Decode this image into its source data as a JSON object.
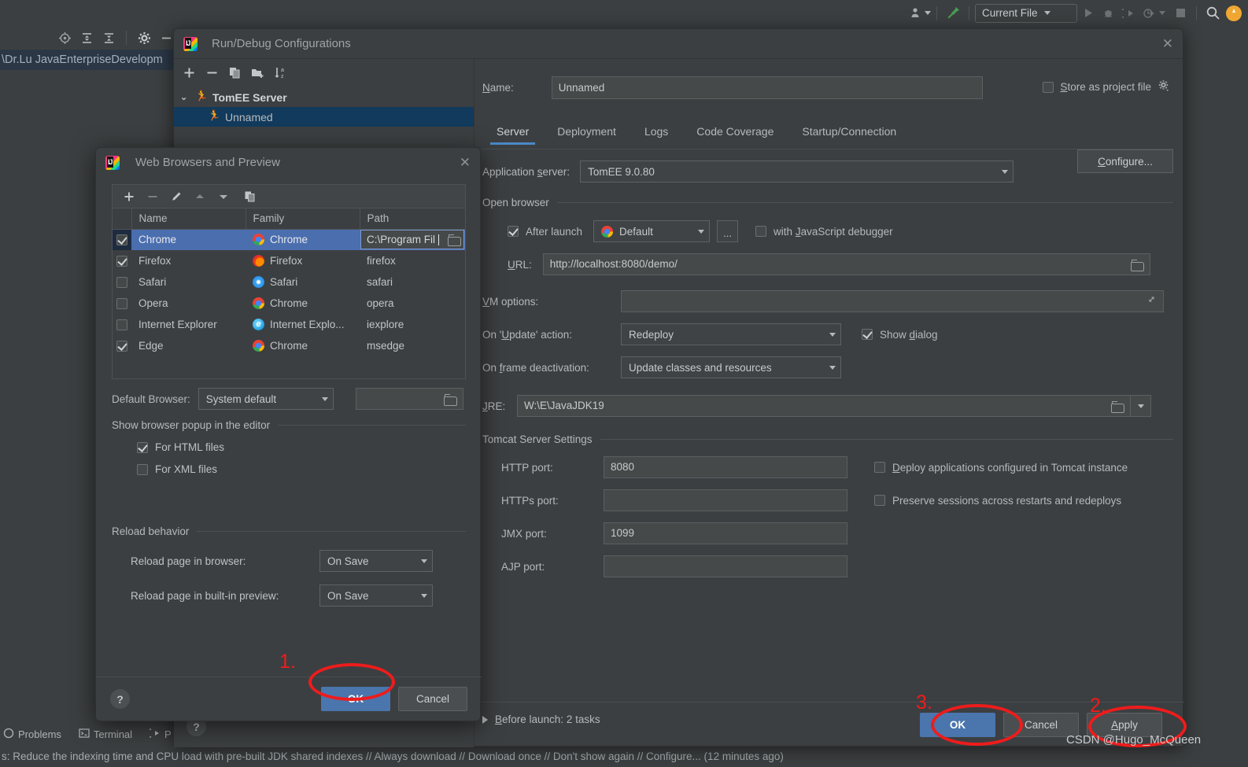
{
  "colors": {
    "bg": "#3c3f41",
    "accent_blue": "#4a75ad",
    "selection_blue": "#4b6eaf",
    "tab_underline": "#4a88c7",
    "annotation_red": "#ee1c1c",
    "tree_selection": "#113a5c"
  },
  "ide": {
    "topbar": {
      "profile_icon": "user-icon",
      "build_icon": "hammer-icon",
      "run_config_selector": "Current File",
      "run_icon": "play-icon",
      "debug_icon": "bug-icon",
      "run_coverage_icon": "run-with-coverage-icon",
      "profiler_icon": "profiler-icon",
      "stop_icon": "stop-icon",
      "search_icon": "search-icon",
      "notification_icon": "notification-icon"
    },
    "left_toolbar_icons": [
      "target-icon",
      "expand-all-icon",
      "collapse-all-icon",
      "gear-icon",
      "minimize-icon"
    ],
    "editor_tab": "\\Dr.Lu JavaEnterpriseDevelopm",
    "statusbar": {
      "items": [
        {
          "label": "Problems",
          "icon": "problems-icon"
        },
        {
          "label": "Terminal",
          "icon": "terminal-icon"
        },
        {
          "label": "P",
          "icon": "run-icon"
        }
      ]
    },
    "notification": "s: Reduce the indexing time and CPU load with pre-built JDK shared indexes // Always download // Download once // Don't show again // Configure... (12 minutes ago)"
  },
  "rundebug": {
    "title": "Run/Debug Configurations",
    "close_icon": "close-icon",
    "tree_toolbar_icons": [
      "add-icon",
      "remove-icon",
      "copy-icon",
      "new-folder-icon",
      "sort-alphabetically-icon"
    ],
    "tree": [
      {
        "label": "TomEE Server",
        "type": "group",
        "expanded": true,
        "chevron": "chevron-down-icon",
        "icon": "tomee-runner-icon"
      },
      {
        "label": "Unnamed",
        "type": "item",
        "selected": true,
        "icon": "tomee-runner-icon"
      }
    ],
    "name_label": "Name:",
    "name_label_mnemonic": "N",
    "name_value": "Unnamed",
    "store_as_project_file": {
      "label": "Store as project file",
      "mnemonic": "S",
      "checked": false,
      "gear_icon": "gear-icon"
    },
    "tabs": [
      {
        "label": "Server",
        "active": true
      },
      {
        "label": "Deployment",
        "active": false
      },
      {
        "label": "Logs",
        "active": false
      },
      {
        "label": "Code Coverage",
        "active": false
      },
      {
        "label": "Startup/Connection",
        "active": false
      }
    ],
    "application_server": {
      "label": "Application server:",
      "mnemonic": "s",
      "value": "TomEE 9.0.80",
      "dropdown_icon": "chevron-down-icon",
      "configure_button": "Configure...",
      "configure_mnemonic": "C"
    },
    "open_browser": {
      "group_label": "Open browser",
      "after_launch": {
        "label": "After launch",
        "checked": true
      },
      "browser_combo": {
        "value": "Default",
        "icon": "chrome-icon",
        "dropdown_icon": "chevron-down-icon"
      },
      "more_button": "...",
      "js_debugger": {
        "label": "with JavaScript debugger",
        "mnemonic": "J",
        "checked": false
      },
      "url_label": "URL:",
      "url_mnemonic": "U",
      "url_value": "http://localhost:8080/demo/",
      "url_browse_icon": "folder-icon"
    },
    "vm_options": {
      "label": "VM options:",
      "mnemonic": "V",
      "value": "",
      "expand_icon": "expand-editor-icon"
    },
    "on_update_action": {
      "label": "On 'Update' action:",
      "mnemonic": "U",
      "value": "Redeploy",
      "dropdown_icon": "chevron-down-icon"
    },
    "show_dialog": {
      "label": "Show dialog",
      "mnemonic": "d",
      "checked": true
    },
    "on_frame_deactivation": {
      "label": "On frame deactivation:",
      "mnemonic": "f",
      "value": "Update classes and resources",
      "dropdown_icon": "chevron-down-icon"
    },
    "jre": {
      "label": "JRE:",
      "mnemonic": "J",
      "value": "W:\\E\\JavaJDK19",
      "browse_icon": "folder-icon",
      "dropdown_icon": "chevron-down-icon"
    },
    "tomcat_settings": {
      "group_label": "Tomcat Server Settings",
      "ports": [
        {
          "label": "HTTP port:",
          "value": "8080"
        },
        {
          "label": "HTTPs port:",
          "value": ""
        },
        {
          "label": "JMX port:",
          "value": "1099"
        },
        {
          "label": "AJP port:",
          "value": ""
        }
      ],
      "checkboxes": [
        {
          "label": "Deploy applications configured in Tomcat instance",
          "mnemonic": "D",
          "checked": false
        },
        {
          "label": "Preserve sessions across restarts and redeploys",
          "checked": false
        }
      ]
    },
    "before_launch": {
      "label": "Before launch: 2 tasks",
      "mnemonic": "B",
      "expand_icon": "triangle-right-icon"
    },
    "buttons": {
      "help": "?",
      "ok": "OK",
      "cancel": "Cancel",
      "apply": "Apply",
      "apply_mnemonic": "A"
    }
  },
  "webbrowsers": {
    "title": "Web Browsers and Preview",
    "close_icon": "close-icon",
    "toolbar_icons": [
      "add-icon",
      "remove-icon",
      "edit-pencil-icon",
      "move-up-icon",
      "move-down-icon",
      "copy-icon"
    ],
    "table": {
      "columns": [
        "",
        "Name",
        "Family",
        "Path"
      ],
      "rows": [
        {
          "checked": true,
          "name": "Chrome",
          "family": "Chrome",
          "family_icon": "chrome-icon",
          "path": "C:\\Program Fil",
          "selected": true,
          "path_editing": true,
          "path_browse_icon": "folder-icon"
        },
        {
          "checked": true,
          "name": "Firefox",
          "family": "Firefox",
          "family_icon": "firefox-icon",
          "path": "firefox",
          "selected": false
        },
        {
          "checked": false,
          "name": "Safari",
          "family": "Safari",
          "family_icon": "safari-icon",
          "path": "safari",
          "selected": false
        },
        {
          "checked": false,
          "name": "Opera",
          "family": "Chrome",
          "family_icon": "chrome-icon",
          "path": "opera",
          "selected": false
        },
        {
          "checked": false,
          "name": "Internet Explorer",
          "family": "Internet Explo...",
          "family_icon": "ie-icon",
          "path": "iexplore",
          "selected": false
        },
        {
          "checked": true,
          "name": "Edge",
          "family": "Chrome",
          "family_icon": "chrome-icon",
          "path": "msedge",
          "selected": false
        }
      ]
    },
    "default_browser": {
      "label": "Default Browser:",
      "value": "System default",
      "dropdown_icon": "chevron-down-icon",
      "path_value": "",
      "browse_icon": "folder-icon"
    },
    "popup_group": {
      "label": "Show browser popup in the editor",
      "items": [
        {
          "label": "For HTML files",
          "checked": true
        },
        {
          "label": "For XML files",
          "checked": false
        }
      ]
    },
    "reload_group": {
      "label": "Reload behavior",
      "items": [
        {
          "label": "Reload page in browser:",
          "value": "On Save",
          "dropdown_icon": "chevron-down-icon"
        },
        {
          "label": "Reload page in built-in preview:",
          "value": "On Save",
          "dropdown_icon": "chevron-down-icon"
        }
      ]
    },
    "buttons": {
      "help": "?",
      "ok": "OK",
      "cancel": "Cancel"
    }
  },
  "annotations": [
    {
      "number": "1.",
      "target": "web-browsers-ok-button"
    },
    {
      "number": "2.",
      "target": "rundebug-apply-button"
    },
    {
      "number": "3.",
      "target": "rundebug-ok-button"
    }
  ],
  "watermark": "CSDN @Hugo_McQueen"
}
